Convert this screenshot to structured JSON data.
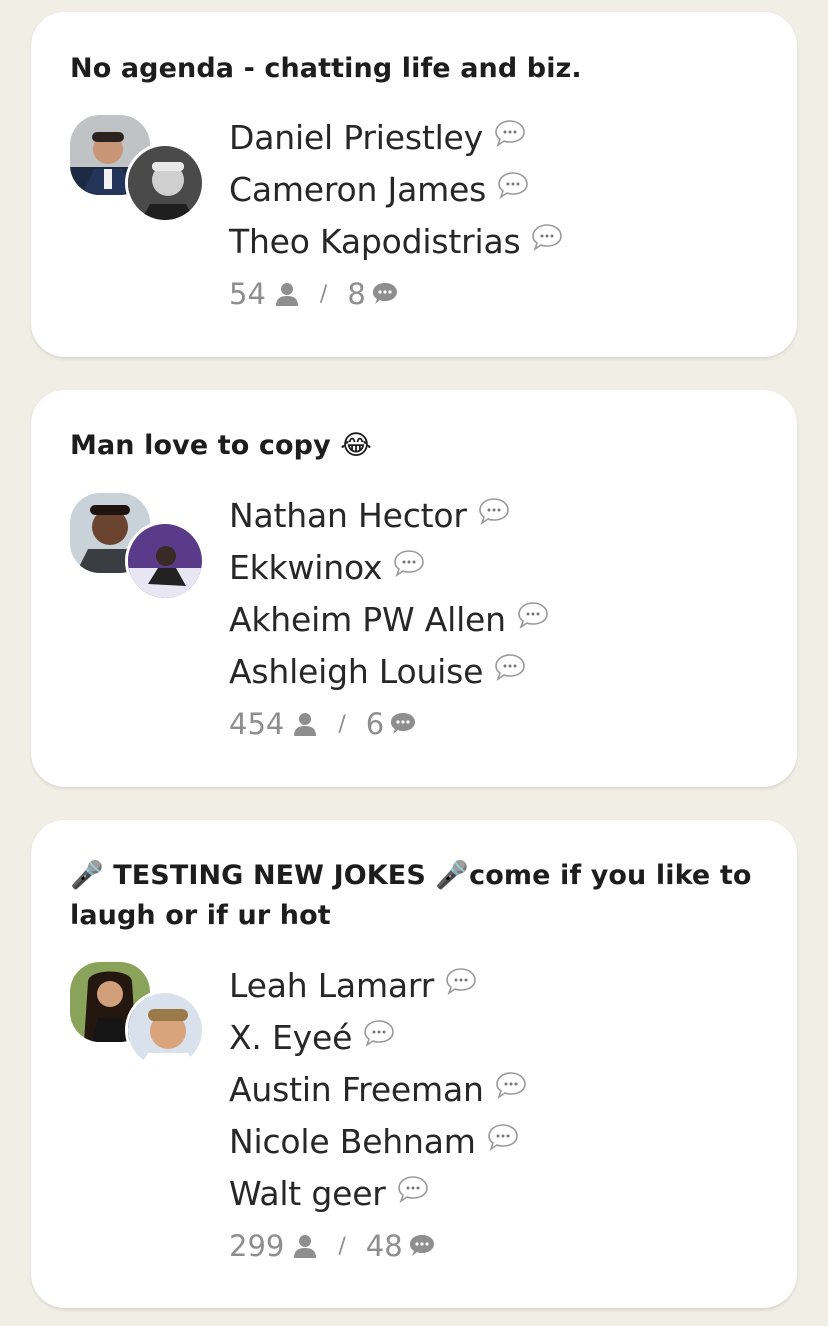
{
  "rooms": [
    {
      "title": "No agenda - chatting life and biz.",
      "speakers": [
        "Daniel Priestley",
        "Cameron James",
        "Theo Kapodistrias"
      ],
      "listeners": "54",
      "speaker_count": "8"
    },
    {
      "title": "Man love to copy 😂",
      "speakers": [
        "Nathan Hector",
        "Ekkwinox",
        "Akheim PW Allen",
        "Ashleigh Louise"
      ],
      "listeners": "454",
      "speaker_count": "6"
    },
    {
      "title": "🎤 TESTING NEW JOKES 🎤come if you like to laugh or if ur hot",
      "speakers": [
        "Leah Lamarr",
        "X. Eyeé",
        "Austin Freeman",
        "Nicole Behnam",
        "Walt geer"
      ],
      "listeners": "299",
      "speaker_count": "48"
    }
  ],
  "icons": {
    "speaking": "speech-bubble-icon",
    "listeners": "person-icon",
    "speakers": "chat-icon"
  },
  "colors": {
    "background": "#F1EFE5",
    "card": "#FFFFFF",
    "meta": "#8E8E8E"
  }
}
